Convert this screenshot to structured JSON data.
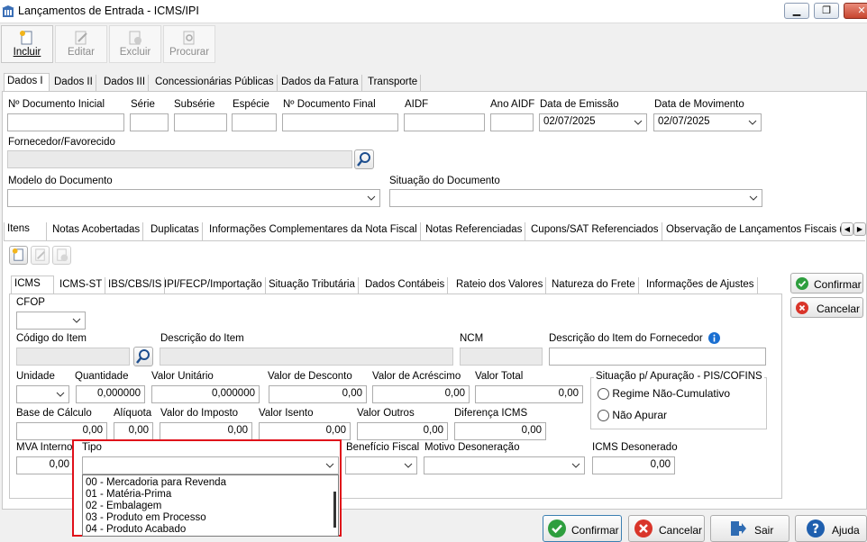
{
  "window": {
    "title": "Lançamentos de Entrada - ICMS/IPI"
  },
  "toolbar": {
    "incluir": "Incluir",
    "editar": "Editar",
    "excluir": "Excluir",
    "procurar": "Procurar"
  },
  "main_tabs": [
    "Dados I",
    "Dados II",
    "Dados III",
    "Concessionárias Públicas",
    "Dados da Fatura",
    "Transporte"
  ],
  "header": {
    "n_doc_ini_label": "Nº Documento Inicial",
    "serie_label": "Série",
    "subserie_label": "Subsérie",
    "especie_label": "Espécie",
    "n_doc_fim_label": "Nº Documento Final",
    "aidf_label": "AIDF",
    "ano_aidf_label": "Ano AIDF",
    "data_emissao_label": "Data de Emissão",
    "data_emissao": "02/07/2025",
    "data_mov_label": "Data de Movimento",
    "data_mov": "02/07/2025",
    "fornecedor_label": "Fornecedor/Favorecido",
    "modelo_label": "Modelo do Documento",
    "situacao_label": "Situação do Documento"
  },
  "item_tabs": [
    "Itens",
    "Notas Acobertadas",
    "Duplicatas",
    "Informações Complementares da Nota Fiscal",
    "Notas Referenciadas",
    "Cupons/SAT Referenciados",
    "Observação de Lançamentos Fiscais (C"
  ],
  "icms_tabs": [
    "ICMS",
    "ICMS-ST",
    "IBS/CBS/IS",
    "IPI/FECP/Importação",
    "Situação Tributária",
    "Dados Contábeis",
    "Rateio dos Valores",
    "Natureza do Frete",
    "Informações de Ajustes"
  ],
  "icms": {
    "cfop_label": "CFOP",
    "cod_item_label": "Código do Item",
    "desc_item_label": "Descrição do Item",
    "ncm_label": "NCM",
    "desc_forn_label": "Descrição do Item do Fornecedor",
    "unidade_label": "Unidade",
    "quantidade_label": "Quantidade",
    "quantidade": "0,000000",
    "valor_unit_label": "Valor Unitário",
    "valor_unit": "0,000000",
    "desconto_label": "Valor de Desconto",
    "desconto": "0,00",
    "acrescimo_label": "Valor de Acréscimo",
    "acrescimo": "0,00",
    "total_label": "Valor Total",
    "total": "0,00",
    "base_label": "Base de Cálculo",
    "base": "0,00",
    "aliquota_label": "Alíquota",
    "aliquota": "0,00",
    "imposto_label": "Valor do Imposto",
    "imposto": "0,00",
    "isento_label": "Valor Isento",
    "isento": "0,00",
    "outros_label": "Valor Outros",
    "outros": "0,00",
    "diferenca_label": "Diferença ICMS",
    "diferenca": "0,00",
    "mva_label": "MVA Interno",
    "mva": "0,00",
    "tipo_label": "Tipo",
    "beneficio_label": "Benefício Fiscal",
    "motivo_label": "Motivo Desoneração",
    "desonerado_label": "ICMS Desonerado",
    "desonerado": "0,00",
    "pis_group_label": "Situação p/ Apuração - PIS/COFINS",
    "radio1": "Regime Não-Cumulativo",
    "radio2": "Não Apurar"
  },
  "tipo_options": [
    "00 - Mercadoria para Revenda",
    "01 - Matéria-Prima",
    "02 - Embalagem",
    "03 - Produto em Processo",
    "04 - Produto Acabado"
  ],
  "side_buttons": {
    "confirmar": "Confirmar",
    "cancelar": "Cancelar"
  },
  "footer": {
    "confirmar": "Confirmar",
    "cancelar": "Cancelar",
    "sair": "Sair",
    "ajuda": "Ajuda"
  },
  "colors": {
    "highlight_border": "#e0101a",
    "confirm_green": "#2e9e3e",
    "cancel_red": "#d9352a",
    "info_blue": "#1a6fd1"
  }
}
